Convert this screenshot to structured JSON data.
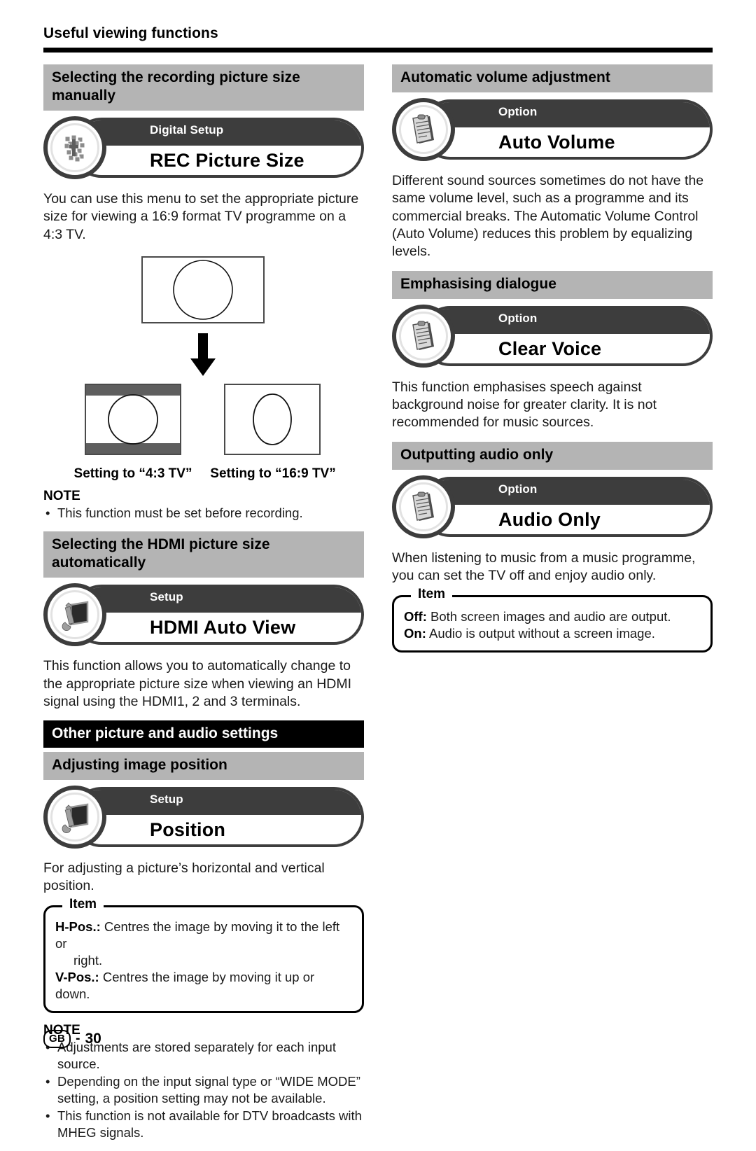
{
  "running_head": "Useful viewing functions",
  "footer": {
    "region_mark": "GB",
    "dash": "-",
    "page_number": "30"
  },
  "colors": {
    "band_gray": "#b4b4b4",
    "band_black": "#000000",
    "pill_dark": "#3d3d3d",
    "letterbox_bar": "#5e5e5e"
  },
  "left_column": {
    "section1": {
      "heading": "Selecting the recording picture size manually",
      "menu": {
        "category": "Digital Setup",
        "title": "REC Picture Size",
        "icon": "digital-blocks-icon"
      },
      "body": "You can use this menu to set the appropriate picture size for viewing a 16:9 format TV programme on a 4:3 TV.",
      "diagram": {
        "source_label": "16:9 source picture with circle",
        "arrow": "down-arrow",
        "caption_left": "Setting to “4:3 TV”",
        "caption_right": "Setting to “16:9 TV”"
      },
      "note": {
        "title": "NOTE",
        "items": [
          "This function must be set before recording."
        ]
      }
    },
    "section2": {
      "heading": "Selecting the HDMI picture size automatically",
      "menu": {
        "category": "Setup",
        "title": "HDMI Auto View",
        "icon": "wrench-monitor-icon"
      },
      "body": "This function allows you to automatically change to the appropriate picture size when viewing an HDMI signal using the HDMI1, 2 and 3 terminals."
    },
    "section3": {
      "band_heading": "Other picture and audio settings",
      "heading": "Adjusting image position",
      "menu": {
        "category": "Setup",
        "title": "Position",
        "icon": "wrench-monitor-icon"
      },
      "body": "For adjusting a picture’s horizontal and vertical position.",
      "item_box": {
        "legend": "Item",
        "rows": [
          {
            "label": "H-Pos.:",
            "text": " Centres the image by moving it to the left or",
            "cont": "right."
          },
          {
            "label": "V-Pos.:",
            "text": " Centres the image by moving it up or down.",
            "cont": ""
          }
        ]
      },
      "note": {
        "title": "NOTE",
        "items": [
          "Adjustments are stored separately for each input source.",
          "Depending on the input signal type or “WIDE MODE” setting, a position setting may not be available.",
          "This function is not available for DTV broadcasts with MHEG signals."
        ]
      }
    }
  },
  "right_column": {
    "section1": {
      "heading": "Automatic volume adjustment",
      "menu": {
        "category": "Option",
        "title": "Auto Volume",
        "icon": "clipboard-icon"
      },
      "body": "Different sound sources sometimes do not have the same volume level, such as a programme and its commercial breaks. The Automatic Volume Control (Auto Volume) reduces this problem by equalizing levels."
    },
    "section2": {
      "heading": "Emphasising dialogue",
      "menu": {
        "category": "Option",
        "title": "Clear Voice",
        "icon": "clipboard-icon"
      },
      "body": "This function emphasises speech against background noise for greater clarity. It is not recommended for music sources."
    },
    "section3": {
      "heading": "Outputting audio only",
      "menu": {
        "category": "Option",
        "title": "Audio Only",
        "icon": "clipboard-icon"
      },
      "body": "When listening to music from a music programme, you can set the TV off and enjoy audio only.",
      "item_box": {
        "legend": "Item",
        "rows": [
          {
            "label": "Off:",
            "text": " Both screen images and audio are output."
          },
          {
            "label": "On:",
            "text": " Audio is output without a screen image."
          }
        ]
      }
    }
  }
}
